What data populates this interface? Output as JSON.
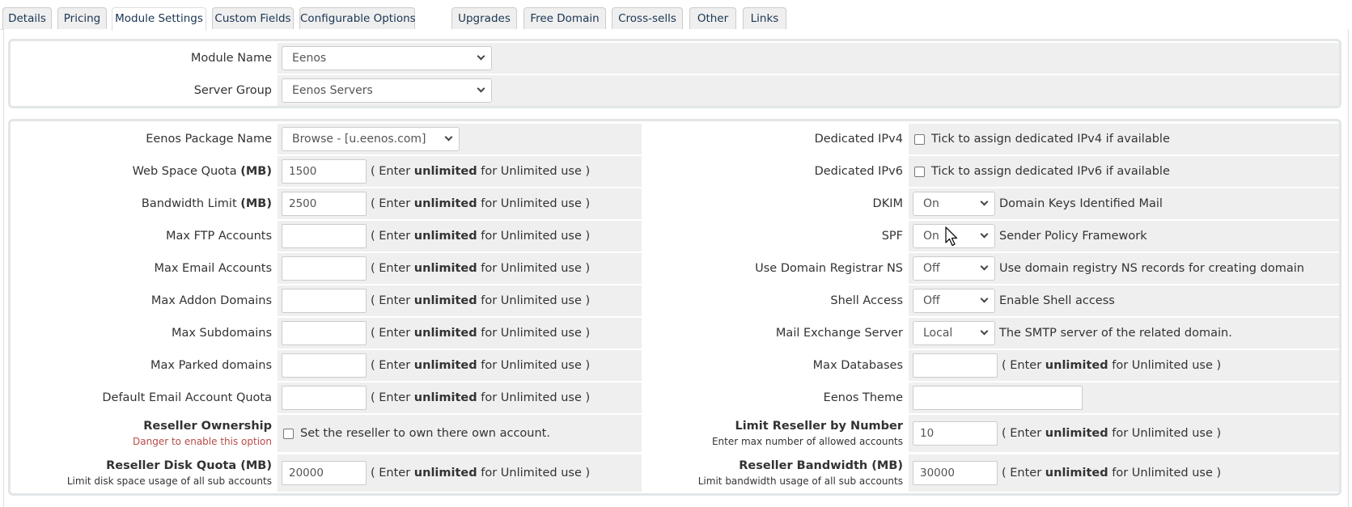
{
  "tabs": [
    {
      "label": "Details",
      "active": false
    },
    {
      "label": "Pricing",
      "active": false
    },
    {
      "label": "Module Settings",
      "active": true
    },
    {
      "label": "Custom Fields",
      "active": false
    },
    {
      "label": "Configurable Options",
      "active": false
    },
    {
      "label": "Upgrades",
      "active": false
    },
    {
      "label": "Free Domain",
      "active": false
    },
    {
      "label": "Cross-sells",
      "active": false
    },
    {
      "label": "Other",
      "active": false
    },
    {
      "label": "Links",
      "active": false
    }
  ],
  "module": {
    "module_name_label": "Module Name",
    "module_name_value": "Eenos",
    "server_group_label": "Server Group",
    "server_group_value": "Eenos Servers"
  },
  "hint": {
    "prefix": "( Enter ",
    "keyword": "unlimited",
    "suffix": " for Unlimited use )"
  },
  "left": {
    "package": {
      "label": "Eenos Package Name",
      "value": "Browse - [u.eenos.com]"
    },
    "web_space": {
      "label": "Web Space Quota",
      "unit": "(MB)",
      "value": "1500"
    },
    "bandwidth": {
      "label": "Bandwidth Limit",
      "unit": "(MB)",
      "value": "2500"
    },
    "ftp": {
      "label": "Max FTP Accounts",
      "value": ""
    },
    "email": {
      "label": "Max Email Accounts",
      "value": ""
    },
    "addon": {
      "label": "Max Addon Domains",
      "value": ""
    },
    "subdomains": {
      "label": "Max Subdomains",
      "value": ""
    },
    "parked": {
      "label": "Max Parked domains",
      "value": ""
    },
    "email_quota": {
      "label": "Default Email Account Quota",
      "value": ""
    },
    "reseller_ownership": {
      "label": "Reseller Ownership",
      "sub": "Danger to enable this option",
      "checkbox_text": "Set the reseller to own there own account.",
      "checked": false
    },
    "reseller_disk": {
      "label": "Reseller Disk Quota (MB)",
      "sub": "Limit disk space usage of all sub accounts",
      "value": "20000"
    }
  },
  "right": {
    "ipv4": {
      "label": "Dedicated IPv4",
      "checkbox_text": "Tick to assign dedicated IPv4 if available",
      "checked": false
    },
    "ipv6": {
      "label": "Dedicated IPv6",
      "checkbox_text": "Tick to assign dedicated IPv6 if available",
      "checked": false
    },
    "dkim": {
      "label": "DKIM",
      "value": "On",
      "desc": "Domain Keys Identified Mail"
    },
    "spf": {
      "label": "SPF",
      "value": "On",
      "desc": "Sender Policy Framework"
    },
    "registrar_ns": {
      "label": "Use Domain Registrar NS",
      "value": "Off",
      "desc": "Use domain registry NS records for creating domain"
    },
    "shell": {
      "label": "Shell Access",
      "value": "Off",
      "desc": "Enable Shell access"
    },
    "mx": {
      "label": "Mail Exchange Server",
      "value": "Local",
      "desc": "The SMTP server of the related domain."
    },
    "databases": {
      "label": "Max Databases",
      "value": ""
    },
    "theme": {
      "label": "Eenos Theme",
      "value": ""
    },
    "limit_reseller": {
      "label": "Limit Reseller by Number",
      "sub": "Enter max number of allowed accounts",
      "value": "10"
    },
    "reseller_bw": {
      "label": "Reseller Bandwidth (MB)",
      "sub": "Limit bandwidth usage of all sub accounts",
      "value": "30000"
    }
  },
  "colors": {
    "danger": "#b94a48",
    "cell_bg": "#efefef",
    "tab_text": "#1a3552"
  }
}
